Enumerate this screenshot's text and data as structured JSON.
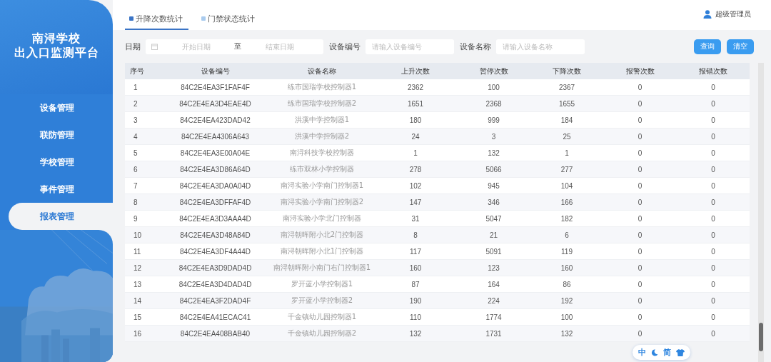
{
  "sidebar": {
    "title_lines": [
      "南浔学校",
      "出入口监测平台"
    ],
    "menu": [
      {
        "label": "设备管理",
        "selected": false
      },
      {
        "label": "联防管理",
        "selected": false
      },
      {
        "label": "学校管理",
        "selected": false
      },
      {
        "label": "事件管理",
        "selected": false
      },
      {
        "label": "报表管理",
        "selected": true
      }
    ]
  },
  "tabs": [
    {
      "label": "升降次数统计",
      "selected": true
    },
    {
      "label": "门禁状态统计",
      "selected": false
    }
  ],
  "user": {
    "name": "超级管理员"
  },
  "filters": {
    "date": {
      "label": "日期",
      "start_placeholder": "开始日期",
      "separator": "至",
      "end_placeholder": "结束日期"
    },
    "device_id": {
      "label": "设备编号",
      "placeholder": "请输入设备编号"
    },
    "device_name": {
      "label": "设备名称",
      "placeholder": "请输入设备名称"
    }
  },
  "buttons": [
    "查询",
    "清空"
  ],
  "table": {
    "columns": [
      "序号",
      "设备编号",
      "设备名称",
      "上升次数",
      "暂停次数",
      "下降次数",
      "报警次数",
      "报错次数"
    ],
    "rows": [
      [
        "1",
        "84C2E4EA3F1FAF4F",
        "练市国瑞学校控制器1",
        "2362",
        "100",
        "2367",
        "0",
        "0"
      ],
      [
        "2",
        "84C2E4EA3D4EAE4D",
        "练市国瑞学校控制器2",
        "1651",
        "2368",
        "1655",
        "0",
        "0"
      ],
      [
        "3",
        "84C2E4EA423DAD42",
        "洪溪中学控制器1",
        "180",
        "999",
        "184",
        "0",
        "0"
      ],
      [
        "4",
        "84C2E4EA4306A643",
        "洪溪中学控制器2",
        "24",
        "3",
        "25",
        "0",
        "0"
      ],
      [
        "5",
        "84C2E4EA3E00A04E",
        "南浔科技学校控制器",
        "1",
        "132",
        "1",
        "0",
        "0"
      ],
      [
        "6",
        "84C2E4EA3D86A64D",
        "练市双林小学控制器",
        "278",
        "5066",
        "277",
        "0",
        "0"
      ],
      [
        "7",
        "84C2E4EA3DA0A04D",
        "南浔实验小学南门控制器1",
        "102",
        "945",
        "104",
        "0",
        "0"
      ],
      [
        "8",
        "84C2E4EA3DFFAF4D",
        "南浔实验小学南门控制器2",
        "147",
        "346",
        "166",
        "0",
        "0"
      ],
      [
        "9",
        "84C2E4EA3D3AAA4D",
        "南浔实验小学北门控制器",
        "31",
        "5047",
        "182",
        "0",
        "0"
      ],
      [
        "10",
        "84C2E4EA3D48A84D",
        "南浔朝晖附小北2门控制器",
        "8",
        "21",
        "6",
        "0",
        "0"
      ],
      [
        "11",
        "84C2E4EA3DF4A44D",
        "南浔朝晖附小北1门控制器",
        "117",
        "5091",
        "119",
        "0",
        "0"
      ],
      [
        "12",
        "84C2E4EA3D9DAD4D",
        "南浔朝晖附小南门右门控制器1",
        "160",
        "123",
        "160",
        "0",
        "0"
      ],
      [
        "13",
        "84C2E4EA3D4DAD4D",
        "罗开蓝小学控制器1",
        "87",
        "164",
        "86",
        "0",
        "0"
      ],
      [
        "14",
        "84C2E4EA3F2DAD4F",
        "罗开蓝小学控制器2",
        "190",
        "224",
        "192",
        "0",
        "0"
      ],
      [
        "15",
        "84C2E4EA41ECAC41",
        "千金镇幼儿园控制器1",
        "110",
        "1774",
        "100",
        "0",
        "0"
      ],
      [
        "16",
        "84C2E4EA408BAB40",
        "千金镇幼儿园控制器2",
        "132",
        "1731",
        "132",
        "0",
        "0"
      ]
    ]
  },
  "floating_toolbar": {
    "labels": [
      "中",
      "简"
    ]
  }
}
